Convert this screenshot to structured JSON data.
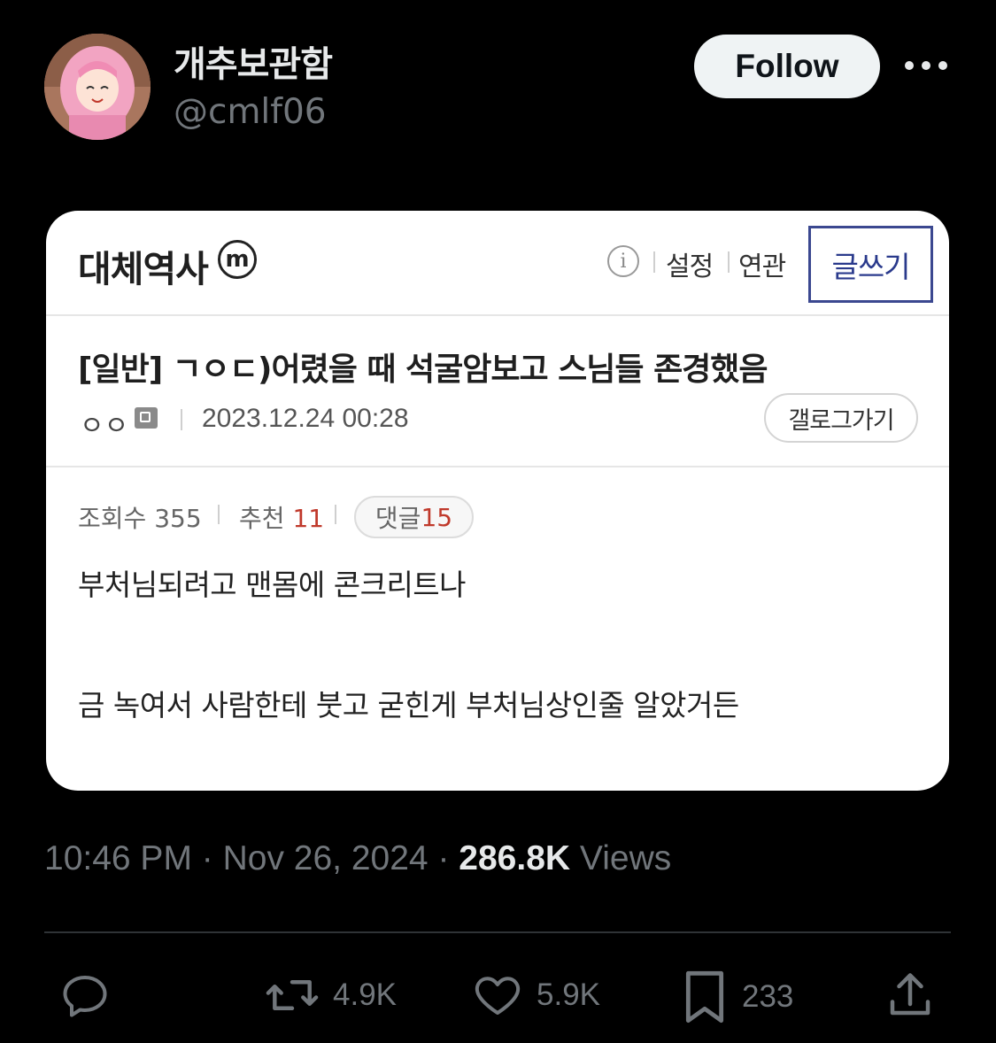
{
  "tweet": {
    "display_name": "개추보관함",
    "handle": "@cmlf06",
    "follow_label": "Follow",
    "time": "10:46 PM",
    "date": "Nov 26, 2024",
    "views_count": "286.8K",
    "views_label": "Views"
  },
  "card": {
    "gallery_name": "대체역사",
    "gallery_badge": "m",
    "info_glyph": "i",
    "settings_label": "설정",
    "related_label": "연관",
    "write_label": "글쓰기",
    "post_title": "[일반] ㄱㅇㄷ)어렸을 때 석굴암보고 스님들 존경했음",
    "author": "ㅇㅇ",
    "post_datetime": "2023.12.24 00:28",
    "go_gallery_label": "갤로그가기",
    "views_label": "조회수",
    "views_value": "355",
    "recommend_label": "추천",
    "recommend_value": "11",
    "comments_label": "댓글",
    "comments_value": "15",
    "body_lines": [
      "부처님되려고 맨몸에 콘크리트나",
      "금 녹여서 사람한테 붓고 굳힌게 부처님상인줄 알았거든"
    ]
  },
  "actions": {
    "reply_count": "",
    "retweet_count": "4.9K",
    "like_count": "5.9K",
    "bookmark_count": "233"
  },
  "colors": {
    "background": "#000000",
    "accent_red": "#c0392b",
    "write_button_border": "#3b4890"
  }
}
